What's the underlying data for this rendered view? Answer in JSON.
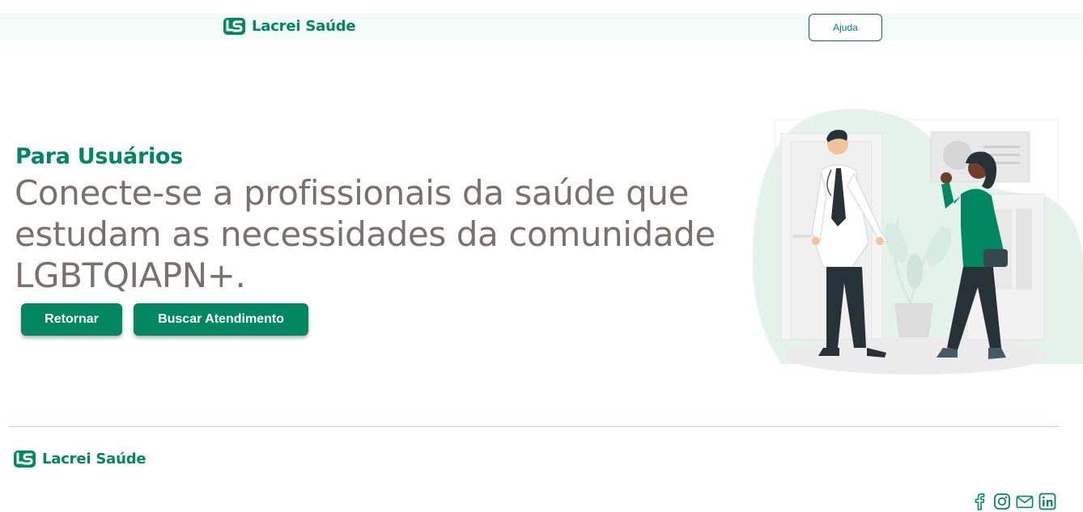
{
  "header": {
    "brand": "Lacrei Saúde",
    "help_label": "Ajuda"
  },
  "hero": {
    "eyebrow": "Para Usuários",
    "headline_lines": [
      "Conecte-se a profissionais da saúde que",
      "estudam as necessidades da comunidade",
      "LGBTQIAPN+."
    ],
    "buttons": {
      "return_label": "Retornar",
      "search_label": "Buscar Atendimento"
    }
  },
  "footer": {
    "brand": "Lacrei Saúde",
    "social_icons": [
      "facebook-icon",
      "instagram-icon",
      "email-icon",
      "linkedin-icon"
    ]
  },
  "colors": {
    "brand_green": "#018762",
    "header_bg": "#f2fbf7",
    "headline_gray": "#7a716e"
  }
}
